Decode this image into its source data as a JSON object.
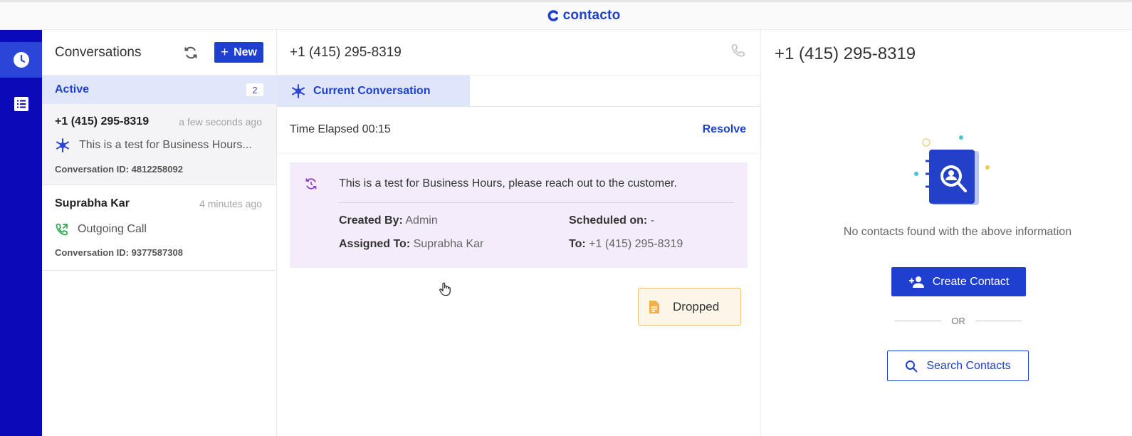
{
  "brand": {
    "name": "contacto"
  },
  "rail": {
    "items": [
      {
        "icon": "clock-icon",
        "active": true
      },
      {
        "icon": "list-icon",
        "active": false
      }
    ]
  },
  "conversations": {
    "title": "Conversations",
    "new_label": "New",
    "active_label": "Active",
    "active_count": "2",
    "items": [
      {
        "name": "+1 (415) 295-8319",
        "time": "a few seconds ago",
        "message": "This is a test for Business Hours...",
        "icon": "spark-icon",
        "id": "Conversation ID: 4812258092"
      },
      {
        "name": "Suprabha Kar",
        "time": "4 minutes ago",
        "message": "Outgoing Call",
        "icon": "outgoing-call-icon",
        "id": "Conversation ID: 9377587308"
      }
    ]
  },
  "center": {
    "phone": "+1 (415) 295-8319",
    "tab_label": "Current Conversation",
    "elapsed": "Time Elapsed 00:15",
    "resolve_label": "Resolve",
    "card": {
      "message": "This is a test for Business Hours, please reach out to the customer.",
      "created_by_label": "Created By:",
      "created_by": "Admin",
      "scheduled_label": "Scheduled on:",
      "scheduled": "-",
      "assigned_label": "Assigned To:",
      "assigned": "Suprabha Kar",
      "to_label": "To:",
      "to": "+1 (415) 295-8319"
    },
    "dropped_label": "Dropped"
  },
  "right": {
    "phone": "+1 (415) 295-8319",
    "empty_text": "No contacts found with the above information",
    "create_label": "Create Contact",
    "or_label": "OR",
    "search_label": "Search Contacts"
  },
  "colors": {
    "primary": "#1e3fd0",
    "rail": "#0a0ab8",
    "card_bg": "#f4ecfb",
    "dropped_border": "#f2c27a"
  }
}
